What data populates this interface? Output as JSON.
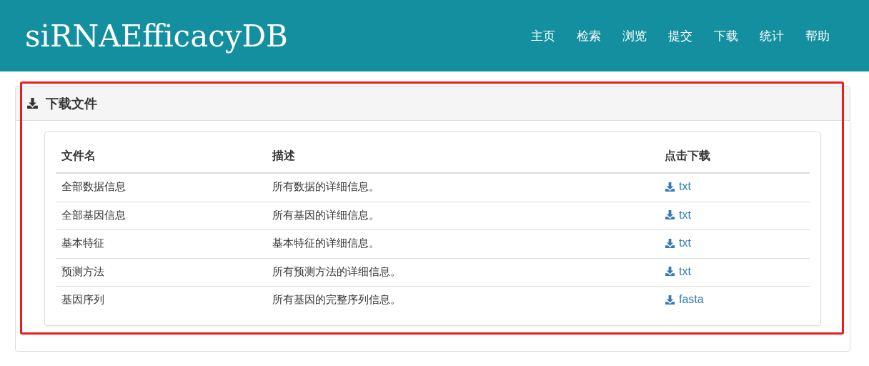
{
  "site_title": "siRNAEfficacyDB",
  "nav": [
    {
      "label": "主页"
    },
    {
      "label": "检索"
    },
    {
      "label": "浏览"
    },
    {
      "label": "提交"
    },
    {
      "label": "下载"
    },
    {
      "label": "统计"
    },
    {
      "label": "帮助"
    }
  ],
  "panel": {
    "title": "下载文件"
  },
  "table": {
    "columns": [
      "文件名",
      "描述",
      "点击下载"
    ],
    "rows": [
      {
        "name": "全部数据信息",
        "description": "所有数据的详细信息。",
        "link": "txt"
      },
      {
        "name": "全部基因信息",
        "description": "所有基因的详细信息。",
        "link": "txt"
      },
      {
        "name": "基本特征",
        "description": "基本特征的详细信息。",
        "link": "txt"
      },
      {
        "name": "预测方法",
        "description": "所有预测方法的详细信息。",
        "link": "txt"
      },
      {
        "name": "基因序列",
        "description": "所有基因的完整序列信息。",
        "link": "fasta"
      }
    ]
  }
}
